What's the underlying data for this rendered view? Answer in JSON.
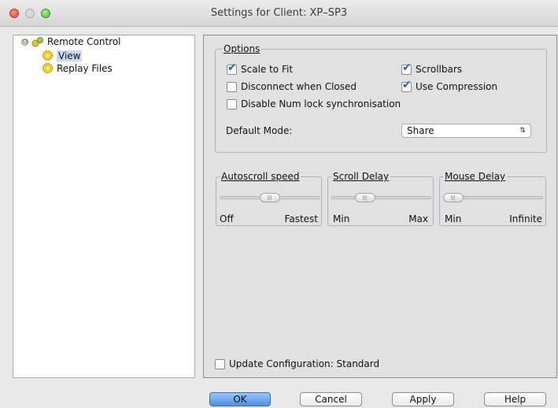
{
  "window": {
    "title": "Settings for Client: XP–SP3"
  },
  "tree": {
    "root": {
      "label": "Remote Control",
      "expander": "⊖"
    },
    "children": [
      {
        "label": "View",
        "selected": true
      },
      {
        "label": "Replay Files",
        "selected": false
      }
    ]
  },
  "options": {
    "legend": "Options",
    "scale_to_fit": {
      "label": "Scale to Fit",
      "checked": true
    },
    "scrollbars": {
      "label": "Scrollbars",
      "checked": true
    },
    "disconnect_when_closed": {
      "label": "Disconnect when Closed",
      "checked": false
    },
    "use_compression": {
      "label": "Use Compression",
      "checked": true
    },
    "disable_num_lock": {
      "label": "Disable Num lock synchronisation",
      "checked": false
    },
    "default_mode": {
      "label": "Default Mode:",
      "value": "Share",
      "arrows": "⇅"
    }
  },
  "sliders": {
    "autoscroll": {
      "legend": "Autoscroll speed",
      "min_label": "Off",
      "max_label": "Fastest",
      "value": 0.5
    },
    "scroll_delay": {
      "legend": "Scroll Delay",
      "min_label": "Min",
      "max_label": "Max",
      "value": 0.3
    },
    "mouse_delay": {
      "legend": "Mouse Delay",
      "min_label": "Min",
      "max_label": "Infinite",
      "value": 0.0
    }
  },
  "update_config": {
    "label": "Update Configuration: Standard",
    "checked": false
  },
  "buttons": {
    "ok": "OK",
    "cancel": "Cancel",
    "apply": "Apply",
    "help": "Help"
  },
  "colors": {
    "accent": "#4d8ee3",
    "check": "#2b5fae"
  }
}
